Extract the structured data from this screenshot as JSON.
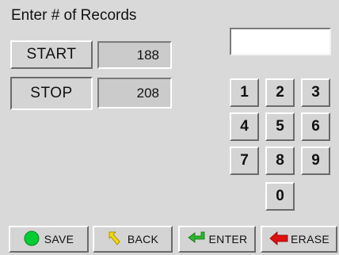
{
  "title": "Enter # of Records",
  "range": {
    "start_label": "START",
    "start_value": "188",
    "stop_label": "STOP",
    "stop_value": "208"
  },
  "entry": {
    "value": ""
  },
  "keypad": {
    "k1": "1",
    "k2": "2",
    "k3": "3",
    "k4": "4",
    "k5": "5",
    "k6": "6",
    "k7": "7",
    "k8": "8",
    "k9": "9",
    "k0": "0"
  },
  "toolbar": {
    "save_label": "SAVE",
    "back_label": "BACK",
    "enter_label": "ENTER",
    "erase_label": "ERASE"
  },
  "icons": {
    "save": "green-circle-icon",
    "back": "yellow-back-arrow-icon",
    "enter": "green-enter-arrow-icon",
    "erase": "red-left-arrow-icon"
  },
  "colors": {
    "save_icon": "#00cc33",
    "back_icon": "#f5d800",
    "enter_icon": "#2bb52b",
    "erase_icon": "#e01010",
    "background": "#d9d9d9"
  }
}
